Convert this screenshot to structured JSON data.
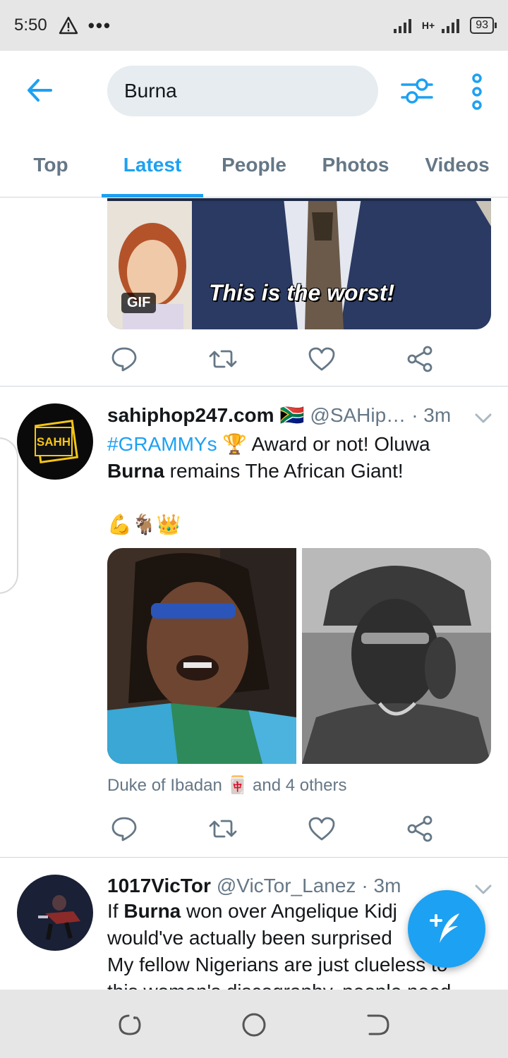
{
  "status_bar": {
    "time": "5:50",
    "network": "H+",
    "battery": "93"
  },
  "header": {
    "search_value": "Burna"
  },
  "tabs": [
    {
      "label": "Top"
    },
    {
      "label": "Latest"
    },
    {
      "label": "People"
    },
    {
      "label": "Photos"
    },
    {
      "label": "Videos"
    }
  ],
  "gif": {
    "badge": "GIF",
    "caption": "This is the worst!"
  },
  "tweets": [
    {
      "name": "sahiphop247.com",
      "flag": "🇿🇦",
      "handle": "@SAHip…",
      "time": "· 3m",
      "hashtag": "#GRAMMYs",
      "trophy": "🏆",
      "text_a": " Award or not! Oluwa",
      "bold": "Burna",
      "text_b": " remains The African Giant!",
      "emojis": "💪🐐👑",
      "liked_by_name": "Duke of Ibadan",
      "liked_by_symbol": "🀄",
      "liked_by_rest": "and 4 others",
      "avatar_text": "SAHH"
    },
    {
      "name": "1017VicTor",
      "handle": "@VicTor_Lanez",
      "time": "· 3m",
      "text_a": "If ",
      "bold": "Burna",
      "text_b": " won over Angelique Kidj",
      "line2": "would've actually been surprised",
      "line3": "My fellow Nigerians are just clueless to",
      "line4": "this woman's discography, people need"
    }
  ],
  "colors": {
    "accent": "#1da1f2",
    "secondary_text": "#657786",
    "divider": "#ccd6dd"
  },
  "icons": [
    "back-arrow-icon",
    "filter-icon",
    "more-vertical-icon",
    "reply-icon",
    "retweet-icon",
    "like-icon",
    "share-icon",
    "chevron-down-icon",
    "compose-icon",
    "warning-icon"
  ]
}
